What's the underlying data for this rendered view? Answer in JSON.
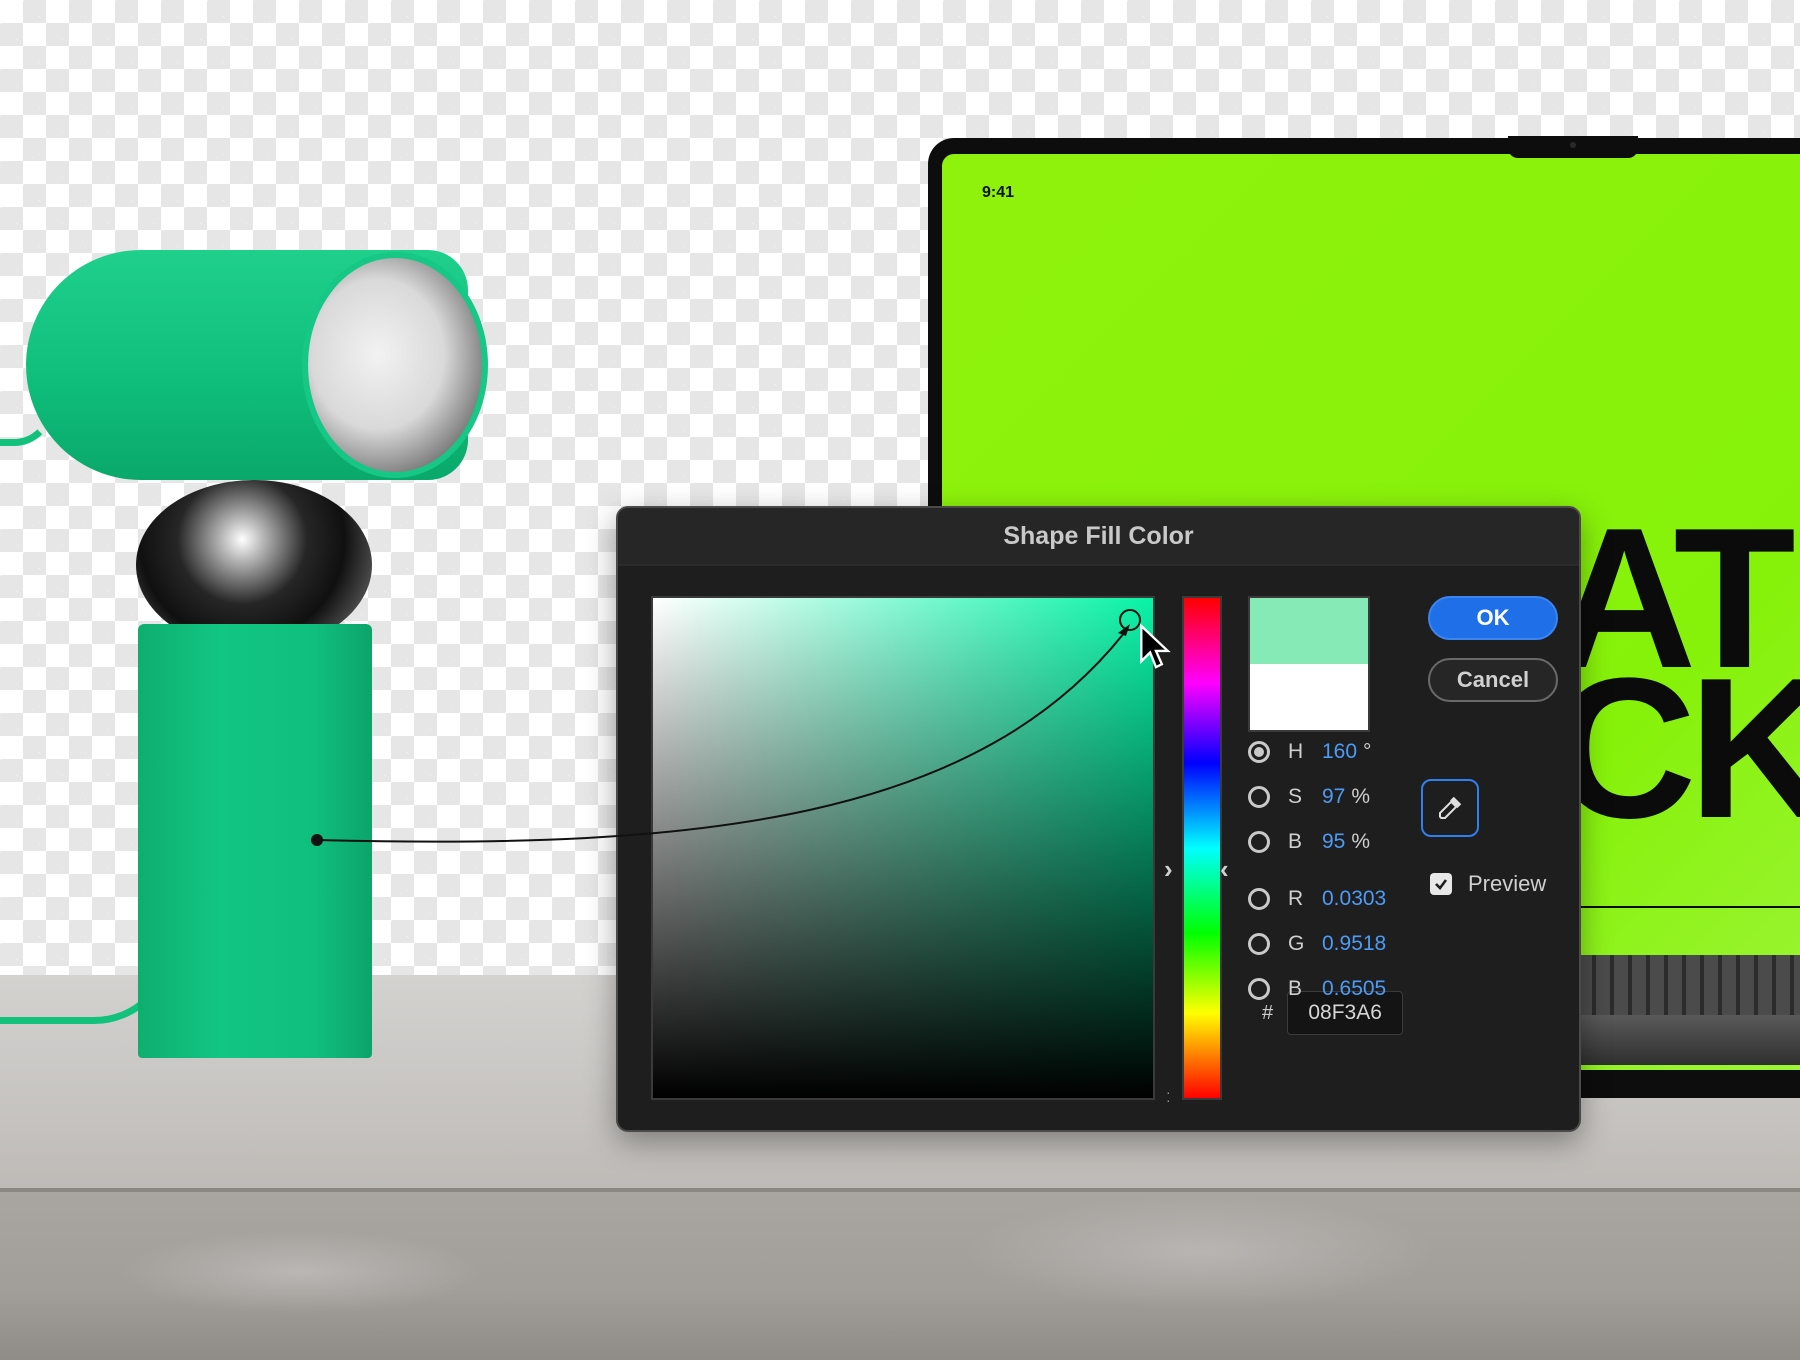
{
  "scene": {
    "screen_time": "9:41",
    "screen_headline": "AT\nCK",
    "lamp_color": "#10c080",
    "screen_color": "#8af20c"
  },
  "dialog": {
    "title": "Shape Fill Color",
    "ok_label": "OK",
    "cancel_label": "Cancel",
    "preview_label": "Preview",
    "preview_checked": true,
    "fields": [
      {
        "label": "H",
        "value": "160",
        "unit": "°",
        "selected": true
      },
      {
        "label": "S",
        "value": "97",
        "unit": "%",
        "selected": false
      },
      {
        "label": "B",
        "value": "95",
        "unit": "%",
        "selected": false
      },
      {
        "label": "R",
        "value": "0.0303",
        "unit": "",
        "selected": false
      },
      {
        "label": "G",
        "value": "0.9518",
        "unit": "",
        "selected": false
      },
      {
        "label": "B",
        "value": "0.6505",
        "unit": "",
        "selected": false
      }
    ],
    "hex_label": "#",
    "hex_value": "08F3A6",
    "new_color": "#85eab5",
    "old_color": "#ffffff",
    "accent_color": "#1f6fe8",
    "value_color": "#4d9bf5"
  },
  "icons": {
    "eyedropper": "eyedropper-icon",
    "checkbox": "checkmark-icon",
    "cursor": "mouse-pointer-icon"
  }
}
